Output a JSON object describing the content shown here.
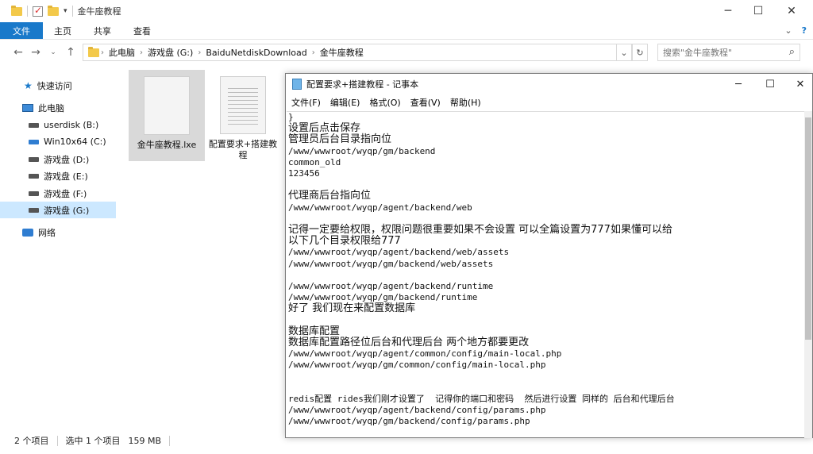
{
  "explorer": {
    "title": "金牛座教程",
    "ribbon_tabs": [
      "文件",
      "主页",
      "共享",
      "查看"
    ],
    "address": [
      "此电脑",
      "游戏盘 (G:)",
      "BaiduNetdiskDownload",
      "金牛座教程"
    ],
    "search_placeholder": "搜索\"金牛座教程\"",
    "nav_items": [
      {
        "label": "快速访问",
        "icon": "star-icon"
      },
      {
        "label": "此电脑",
        "icon": "computer-icon"
      },
      {
        "label": "userdisk (B:)",
        "icon": "drive-icon"
      },
      {
        "label": "Win10x64 (C:)",
        "icon": "drive-icon"
      },
      {
        "label": "游戏盘 (D:)",
        "icon": "drive-icon"
      },
      {
        "label": "游戏盘 (E:)",
        "icon": "drive-icon"
      },
      {
        "label": "游戏盘 (F:)",
        "icon": "drive-icon"
      },
      {
        "label": "游戏盘 (G:)",
        "icon": "drive-icon"
      },
      {
        "label": "网络",
        "icon": "network-icon"
      }
    ],
    "files": [
      {
        "name": "金牛座教程.lxe"
      },
      {
        "name": "配置要求+搭建教程"
      }
    ],
    "status": {
      "count": "2 个项目",
      "selected": "选中 1 个项目",
      "size": "159 MB"
    }
  },
  "notepad": {
    "title": "配置要求+搭建教程 - 记事本",
    "menu": [
      "文件(F)",
      "编辑(E)",
      "格式(O)",
      "查看(V)",
      "帮助(H)"
    ],
    "lines": [
      "}",
      "设置后点击保存",
      "管理员后台目录指向位",
      "/www/wwwroot/wyqp/gm/backend",
      "common_old",
      "123456",
      "",
      "代理商后台指向位",
      "/www/wwwroot/wyqp/agent/backend/web",
      "",
      "记得一定要给权限，权限问题很重要如果不会设置 可以全篇设置为777如果懂可以给",
      "以下几个目录权限给777",
      "/www/wwwroot/wyqp/agent/backend/web/assets",
      "/www/wwwroot/wyqp/gm/backend/web/assets",
      "",
      "/www/wwwroot/wyqp/agent/backend/runtime",
      "/www/wwwroot/wyqp/gm/backend/runtime",
      "好了 我们现在来配置数据库",
      "",
      "数据库配置",
      "数据库配置路径位后台和代理后台 两个地方都要更改",
      "/www/wwwroot/wyqp/agent/common/config/main-local.php",
      "/www/wwwroot/wyqp/gm/common/config/main-local.php",
      "",
      "",
      "redis配置 rides我们刚才设置了  记得你的端口和密码  然后进行设置 同样的 后台和代理后台",
      "/www/wwwroot/wyqp/agent/backend/config/params.php",
      "/www/wwwroot/wyqp/gm/backend/config/params.php"
    ]
  }
}
